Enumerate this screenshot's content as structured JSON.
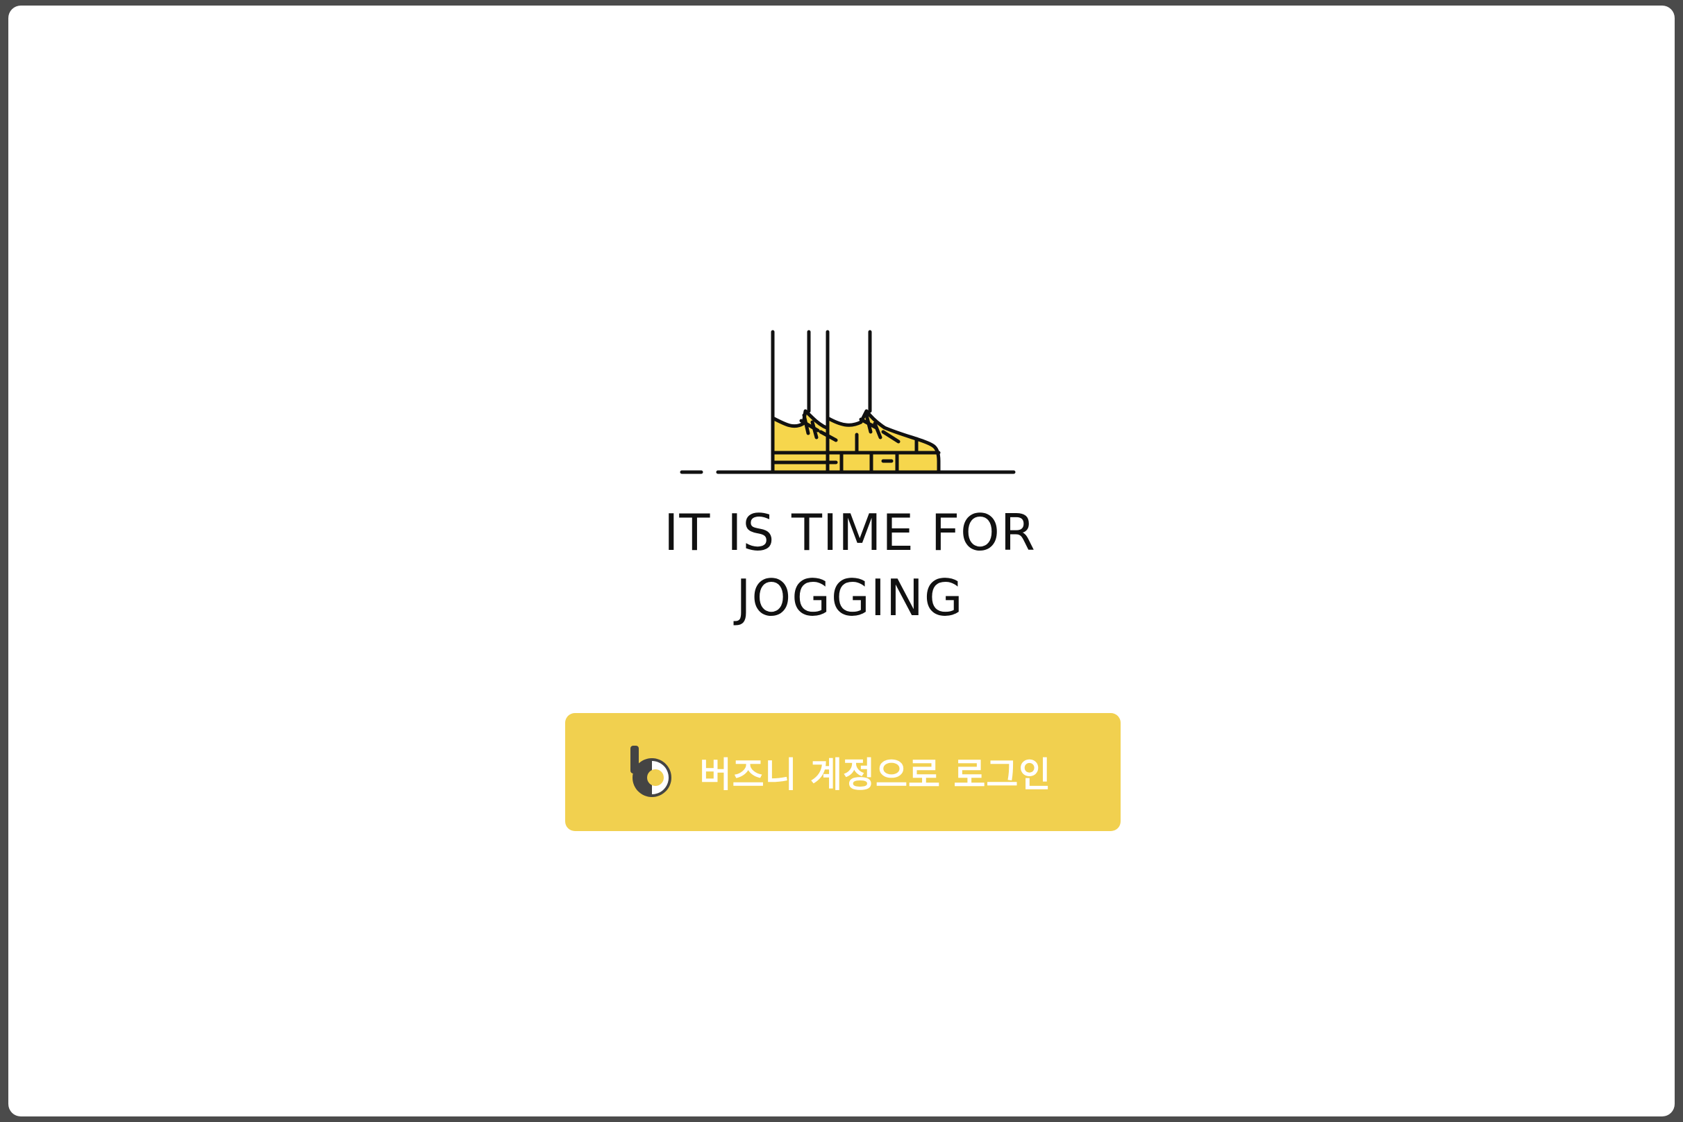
{
  "illustration": {
    "icon": "jogging-shoes-icon",
    "shoe_color": "#f6d64c",
    "line_color": "#111111"
  },
  "headline": {
    "line1": "IT IS TIME FOR",
    "line2": "JOGGING"
  },
  "login_button": {
    "label": "버즈니 계정으로 로그인",
    "logo_icon": "buzzni-logo-icon",
    "background": "#f1d04f",
    "text_color": "#ffffff"
  }
}
